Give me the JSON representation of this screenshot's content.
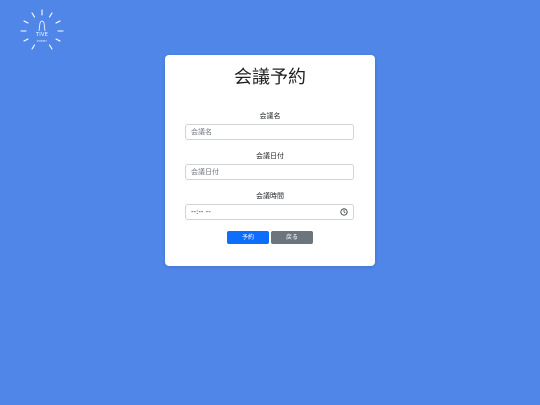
{
  "logo": {
    "icon": "sun-rays-icon",
    "text": "TIVE",
    "subtext": "EVENT"
  },
  "form": {
    "title": "会議予約",
    "fields": [
      {
        "label": "会議名",
        "placeholder": "会議名"
      },
      {
        "label": "会議日付",
        "placeholder": "会議日付"
      },
      {
        "label": "会議時間",
        "value": "--:-- --",
        "icon": "clock-icon"
      }
    ],
    "buttons": {
      "submit_label": "予約",
      "cancel_label": "戻る"
    }
  },
  "colors": {
    "background": "#4f86e8",
    "card": "#ffffff",
    "primary": "#0d6efd",
    "secondary": "#6c757d"
  }
}
